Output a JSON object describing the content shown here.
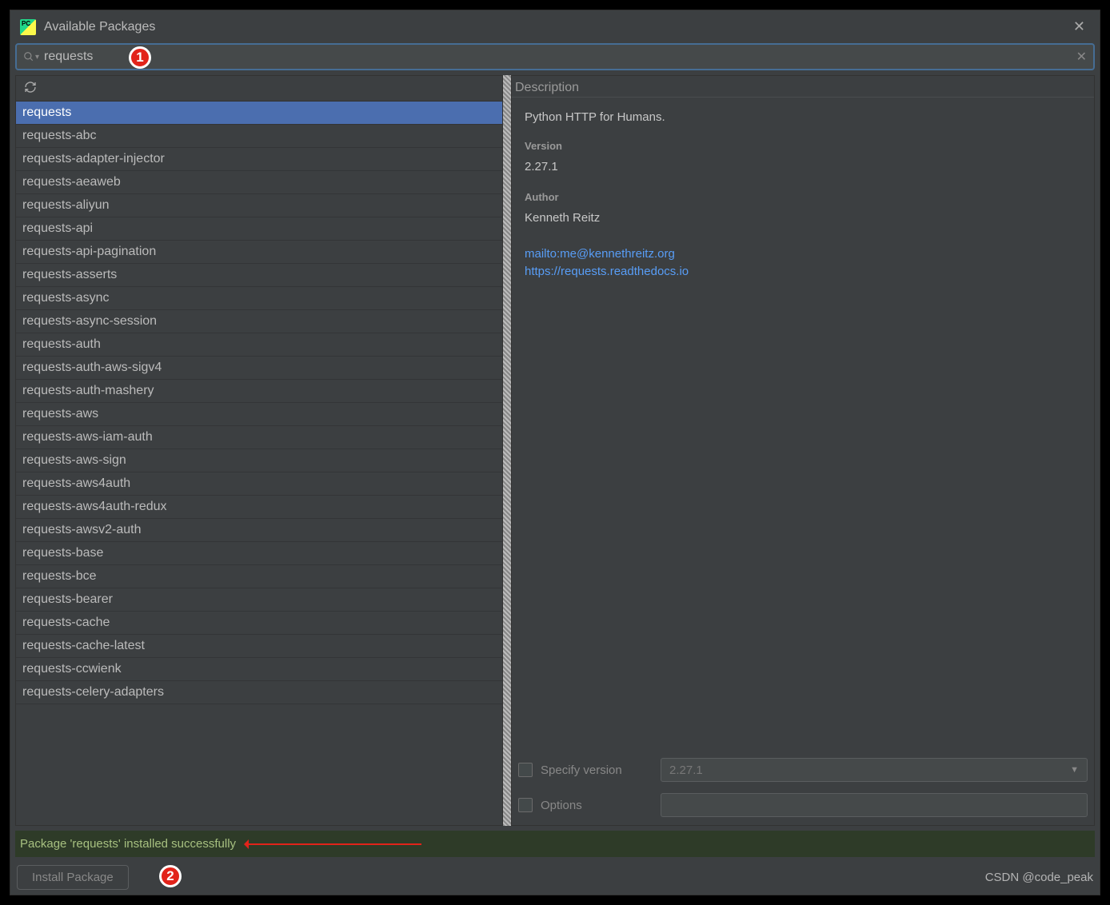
{
  "window": {
    "title": "Available Packages"
  },
  "search": {
    "value": "requests"
  },
  "annotations": {
    "badge1": "1",
    "badge2": "2"
  },
  "packages": [
    "requests",
    "requests-abc",
    "requests-adapter-injector",
    "requests-aeaweb",
    "requests-aliyun",
    "requests-api",
    "requests-api-pagination",
    "requests-asserts",
    "requests-async",
    "requests-async-session",
    "requests-auth",
    "requests-auth-aws-sigv4",
    "requests-auth-mashery",
    "requests-aws",
    "requests-aws-iam-auth",
    "requests-aws-sign",
    "requests-aws4auth",
    "requests-aws4auth-redux",
    "requests-awsv2-auth",
    "requests-base",
    "requests-bce",
    "requests-bearer",
    "requests-cache",
    "requests-cache-latest",
    "requests-ccwienk",
    "requests-celery-adapters"
  ],
  "selected_index": 0,
  "description": {
    "header": "Description",
    "summary": "Python HTTP for Humans.",
    "version_label": "Version",
    "version": "2.27.1",
    "author_label": "Author",
    "author": "Kenneth Reitz",
    "links": [
      "mailto:me@kennethreitz.org",
      "https://requests.readthedocs.io"
    ]
  },
  "options": {
    "specify_version_label": "Specify version",
    "specify_version_value": "2.27.1",
    "options_label": "Options",
    "options_value": ""
  },
  "status": "Package 'requests' installed successfully",
  "footer": {
    "install_label": "Install Package",
    "watermark": "CSDN @code_peak"
  }
}
